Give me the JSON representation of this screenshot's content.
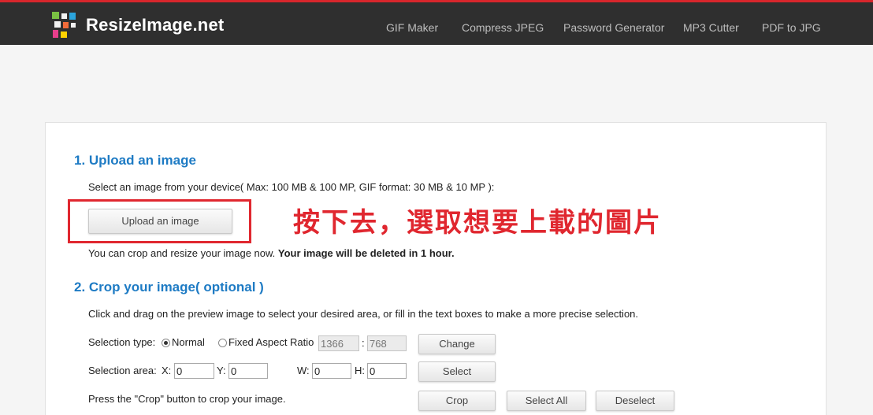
{
  "header": {
    "brand": "ResizeImage.net",
    "nav": [
      "GIF Maker",
      "Compress JPEG",
      "Password Generator",
      "MP3 Cutter",
      "PDF to JPG"
    ],
    "colors": {
      "bar": "#2f2f2f",
      "accent_line": "#d8262c"
    }
  },
  "step1": {
    "title": "1. Upload an image",
    "hint": "Select an image from your device( Max: 100 MB & 100 MP, GIF format: 30 MB & 10 MP ):",
    "upload_label": "Upload an image",
    "note_plain": "You can crop and resize your image now.",
    "note_bold": "Your image will be deleted in 1 hour."
  },
  "annotation": {
    "text": "按下去，選取想要上載的圖片",
    "color": "#e0272f"
  },
  "step2": {
    "title": "2. Crop your image( optional )",
    "hint": "Click and drag on the preview image to select your desired area, or fill in the text boxes to make a more precise selection.",
    "selection_type_label": "Selection type:",
    "normal_label": "Normal",
    "fixed_label": "Fixed Aspect Ratio",
    "ratio_w": "1366",
    "ratio_sep": ":",
    "ratio_h": "768",
    "change_label": "Change",
    "area_label": "Selection area:",
    "x_label": "X:",
    "x_value": "0",
    "y_label": "Y:",
    "y_value": "0",
    "w_label": "W:",
    "w_value": "0",
    "h_label": "H:",
    "h_value": "0",
    "select_label": "Select",
    "crop_hint": "Press the \"Crop\" button to crop your image.",
    "crop_label": "Crop",
    "select_all_label": "Select All",
    "deselect_label": "Deselect",
    "title_color": "#1e7bc4"
  }
}
